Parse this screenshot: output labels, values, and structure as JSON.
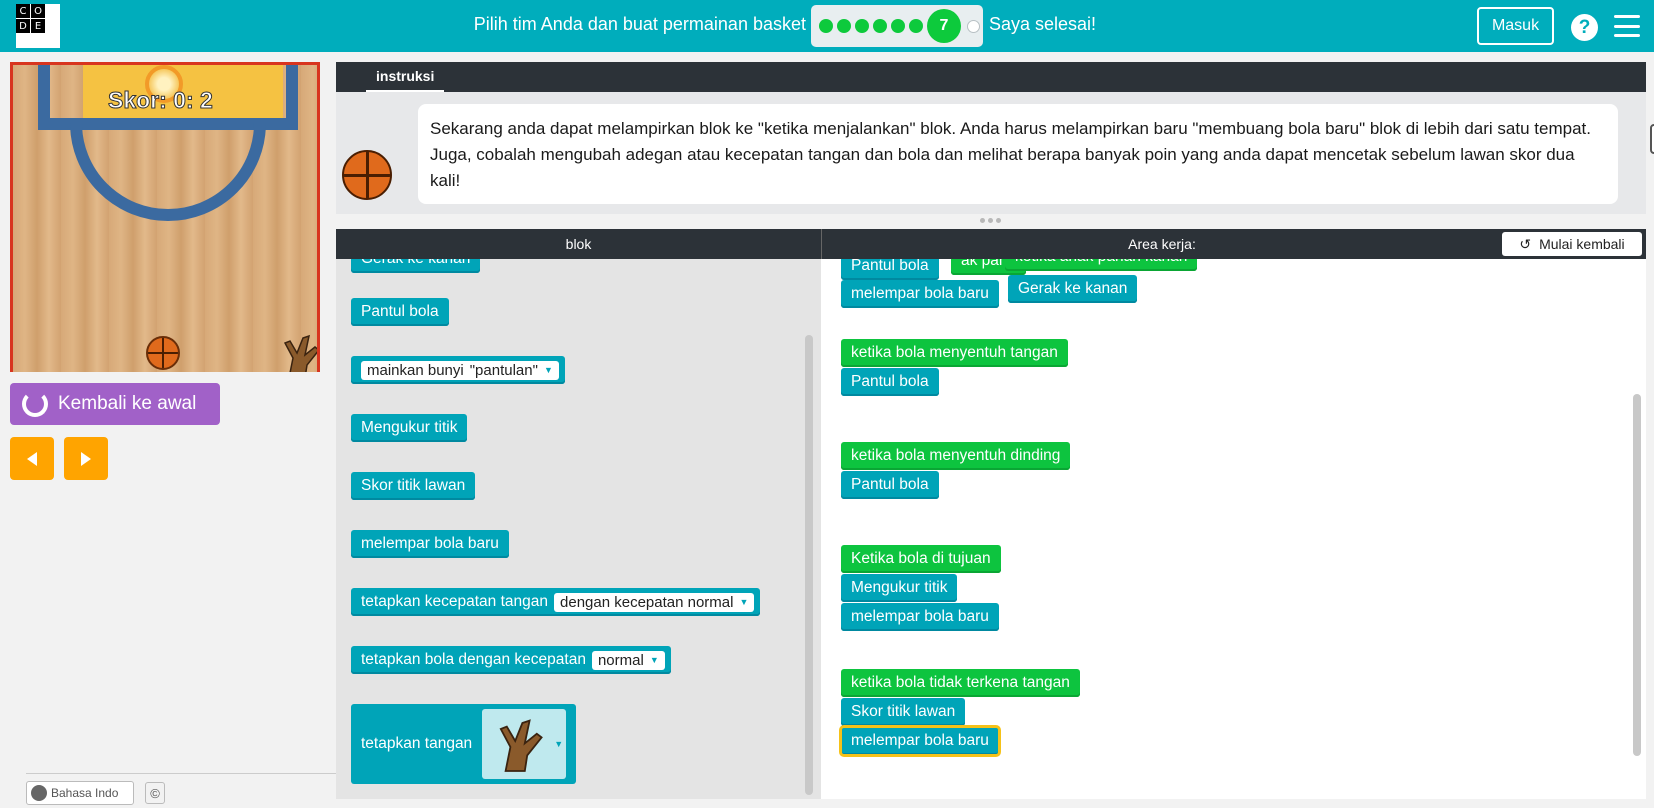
{
  "header": {
    "logo_letters": [
      "C",
      "O",
      "",
      "D",
      "E",
      ""
    ],
    "level_title": "Pilih tim Anda dan buat permainan basket",
    "progress": {
      "completed_dots": 6,
      "current_level": "7",
      "remaining_dots": 1
    },
    "done_label": "Saya selesai!",
    "signin_label": "Masuk",
    "help_label": "?"
  },
  "game": {
    "score_text": "Skor: 0: 2",
    "reset_label": "Kembali ke awal"
  },
  "footer": {
    "language": "Bahasa Indo",
    "copyright_symbol": "©"
  },
  "instructions": {
    "tab_label": "instruksi",
    "text": "Sekarang anda dapat melampirkan blok ke \"ketika menjalankan\" blok. Anda harus melampirkan baru \"membuang bola baru\" blok di lebih dari satu tempat. Juga, cobalah mengubah adegan atau kecepatan tangan dan bola dan melihat berapa banyak poin yang anda dapat mencetak sebelum lawan skor dua kali!"
  },
  "workspace_header": {
    "blocks_title": "blok",
    "area_title": "Area kerja:",
    "restart_label": "Mulai kembali"
  },
  "toolbox": {
    "blocks": [
      "Gerak ke kanan",
      "Pantul bola",
      "mainkan bunyi",
      "Mengukur titik",
      "Skor titik lawan",
      "melempar bola baru",
      "tetapkan kecepatan tangan",
      "tetapkan bola dengan kecepatan",
      "tetapkan tangan"
    ],
    "sound_value": "\"pantulan\"",
    "hand_speed_value": "dengan kecepatan normal",
    "ball_speed_value": "normal"
  },
  "workspace": {
    "top_blocks": [
      "Pantul bola",
      "ak pana",
      "ketika anak panah kanan",
      "melempar bola baru",
      "Gerak ke kanan"
    ],
    "groups": [
      {
        "event": "ketika bola menyentuh tangan",
        "actions": [
          "Pantul bola"
        ]
      },
      {
        "event": "ketika bola menyentuh dinding",
        "actions": [
          "Pantul bola"
        ]
      },
      {
        "event": "Ketika bola di tujuan",
        "actions": [
          "Mengukur titik",
          "melempar bola baru"
        ]
      },
      {
        "event": "ketika bola tidak terkena tangan",
        "actions": [
          "Skor titik lawan",
          "melempar bola baru"
        ]
      }
    ]
  },
  "colors": {
    "header": "#00adbc",
    "event_block": "#0dc43f",
    "action_block": "#00a4b8",
    "reset_button": "#a161c8",
    "arrow_button": "#ffa400",
    "selected_outline": "#f5c218"
  }
}
